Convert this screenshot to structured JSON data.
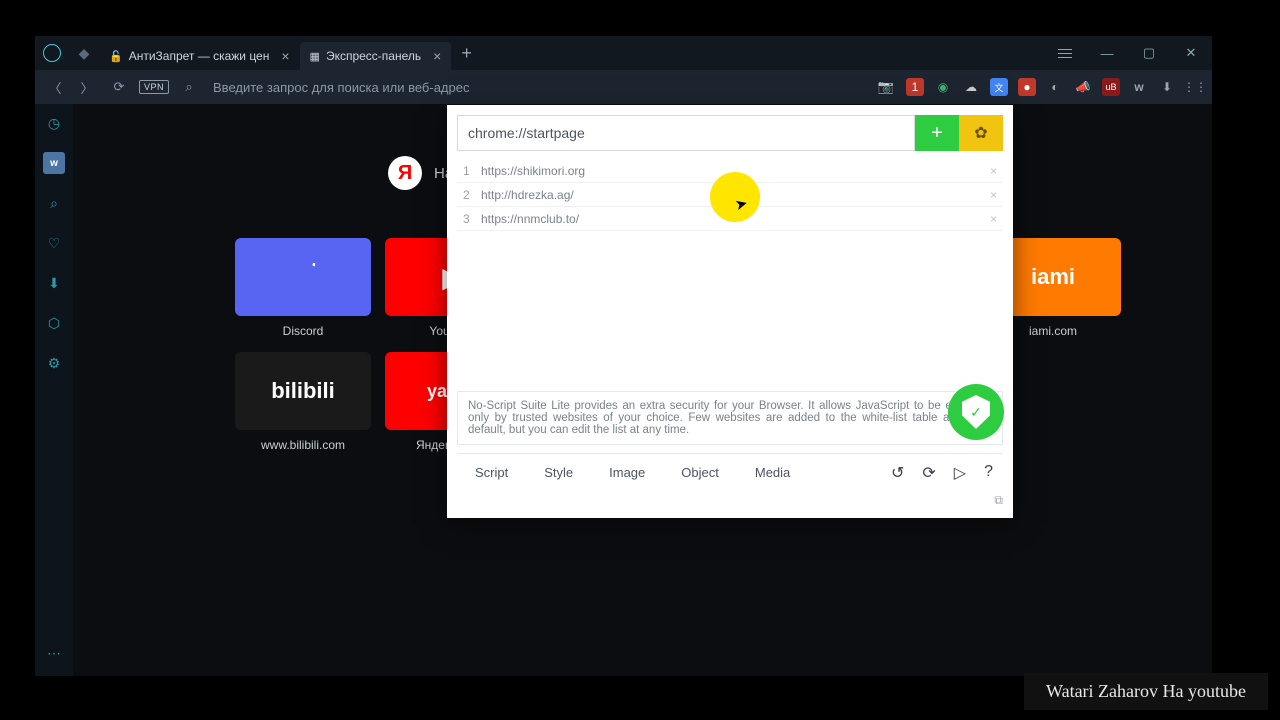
{
  "tabs": [
    {
      "label": "АнтиЗапрет — скажи цен",
      "favicon": "lock-open"
    },
    {
      "label": "Экспресс-панель",
      "favicon": "grid"
    }
  ],
  "navbar": {
    "vpn": "VPN",
    "placeholder": "Введите запрос для поиска или веб-адрес"
  },
  "yandex": {
    "logo": "Я",
    "hint": "Найти"
  },
  "tiles": [
    {
      "label": "Discord",
      "cls": "t-discord",
      "icon": "discord"
    },
    {
      "label": "YouTube",
      "cls": "t-yt",
      "icon": "▶"
    },
    {
      "label": "",
      "cls": "t-blank",
      "icon": ""
    },
    {
      "label": "",
      "cls": "t-blank",
      "icon": ""
    },
    {
      "label": "",
      "cls": "t-blank",
      "icon": ""
    },
    {
      "label": "iami.com",
      "cls": "t-orange",
      "icon": "iami"
    },
    {
      "label": "www.bilibili.com",
      "cls": "t-bili",
      "icon": "bilibili"
    },
    {
      "label": "Яндекс.Музы",
      "cls": "t-yandex",
      "icon": "yande"
    }
  ],
  "popup": {
    "url": "chrome://startpage",
    "whitelist": [
      {
        "n": "1",
        "url": "https://shikimori.org"
      },
      {
        "n": "2",
        "url": "http://hdrezka.ag/"
      },
      {
        "n": "3",
        "url": "https://nnmclub.to/"
      }
    ],
    "desc": "No-Script Suite Lite provides an extra security for your Browser. It allows JavaScript to be executed only by trusted websites of your choice. Few websites are added to the white-list table above by default, but you can edit the list at any time.",
    "tabs": [
      "Script",
      "Style",
      "Image",
      "Object",
      "Media"
    ]
  },
  "watermark": "Watari Zaharov На youtube"
}
